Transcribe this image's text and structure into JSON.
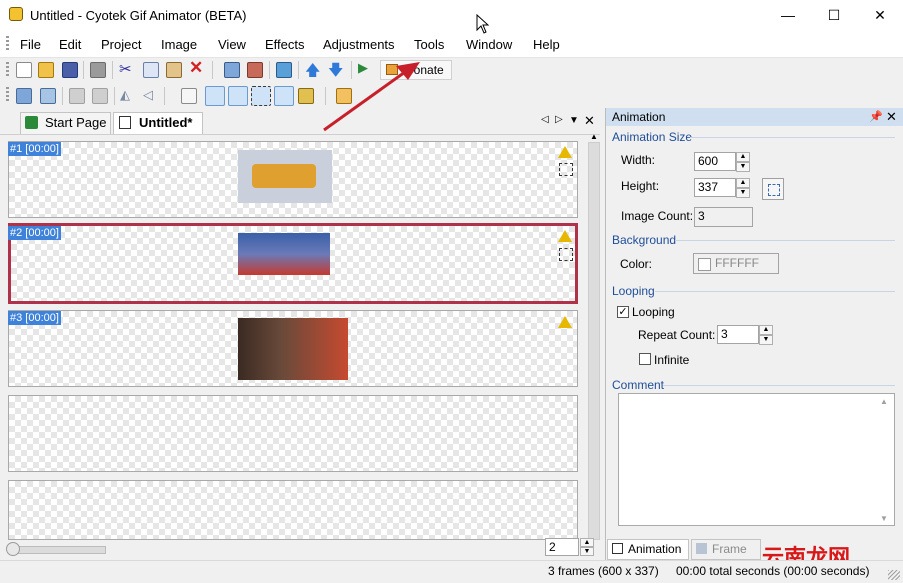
{
  "window": {
    "title": "Untitled - Cyotek Gif Animator (BETA)",
    "controls": {
      "minimize": "—",
      "maximize": "☐",
      "close": "✕"
    }
  },
  "menu": [
    "File",
    "Edit",
    "Project",
    "Image",
    "View",
    "Effects",
    "Adjustments",
    "Tools",
    "Window",
    "Help"
  ],
  "toolbar": {
    "donate_label": "Donate"
  },
  "document_tabs": [
    {
      "label": "Start Page",
      "active": false
    },
    {
      "label": "Untitled*",
      "active": true
    }
  ],
  "frames": [
    {
      "label": "#1 [00:00]",
      "selected": false,
      "warning": true,
      "thumb_colors": [
        "#c9cfdb",
        "#e0a030"
      ]
    },
    {
      "label": "#2 [00:00]",
      "selected": true,
      "warning": true,
      "thumb_colors": [
        "#3a5fa8",
        "#c43a30"
      ]
    },
    {
      "label": "#3 [00:00]",
      "selected": false,
      "warning": true,
      "thumb_colors": [
        "#3a2a22",
        "#c64a30"
      ]
    },
    {
      "label": "",
      "selected": false,
      "warning": false
    },
    {
      "label": "",
      "selected": false,
      "warning": false
    }
  ],
  "zoom_value": "2",
  "status": {
    "frames": "3 frames (600 x 337)",
    "duration": "00:00 total seconds (00:00 seconds)"
  },
  "panel": {
    "title": "Animation",
    "sections": {
      "size": "Animation Size",
      "background": "Background",
      "looping": "Looping",
      "comment": "Comment"
    },
    "width_label": "Width:",
    "width_value": "600",
    "height_label": "Height:",
    "height_value": "337",
    "image_count_label": "Image Count:",
    "image_count_value": "3",
    "color_label": "Color:",
    "color_value": "FFFFFF",
    "looping_label": "Looping",
    "looping_checked": true,
    "repeat_count_label": "Repeat Count:",
    "repeat_count_value": "3",
    "infinite_label": "Infinite",
    "infinite_checked": false,
    "comment_value": "",
    "tabs": [
      "Animation",
      "Frame"
    ]
  },
  "watermark": "云南龙网",
  "colors": {
    "accent": "#3f82d9",
    "selected_border": "#b0324a",
    "section_head": "#1f4e99",
    "arrow": "#c8202a"
  }
}
